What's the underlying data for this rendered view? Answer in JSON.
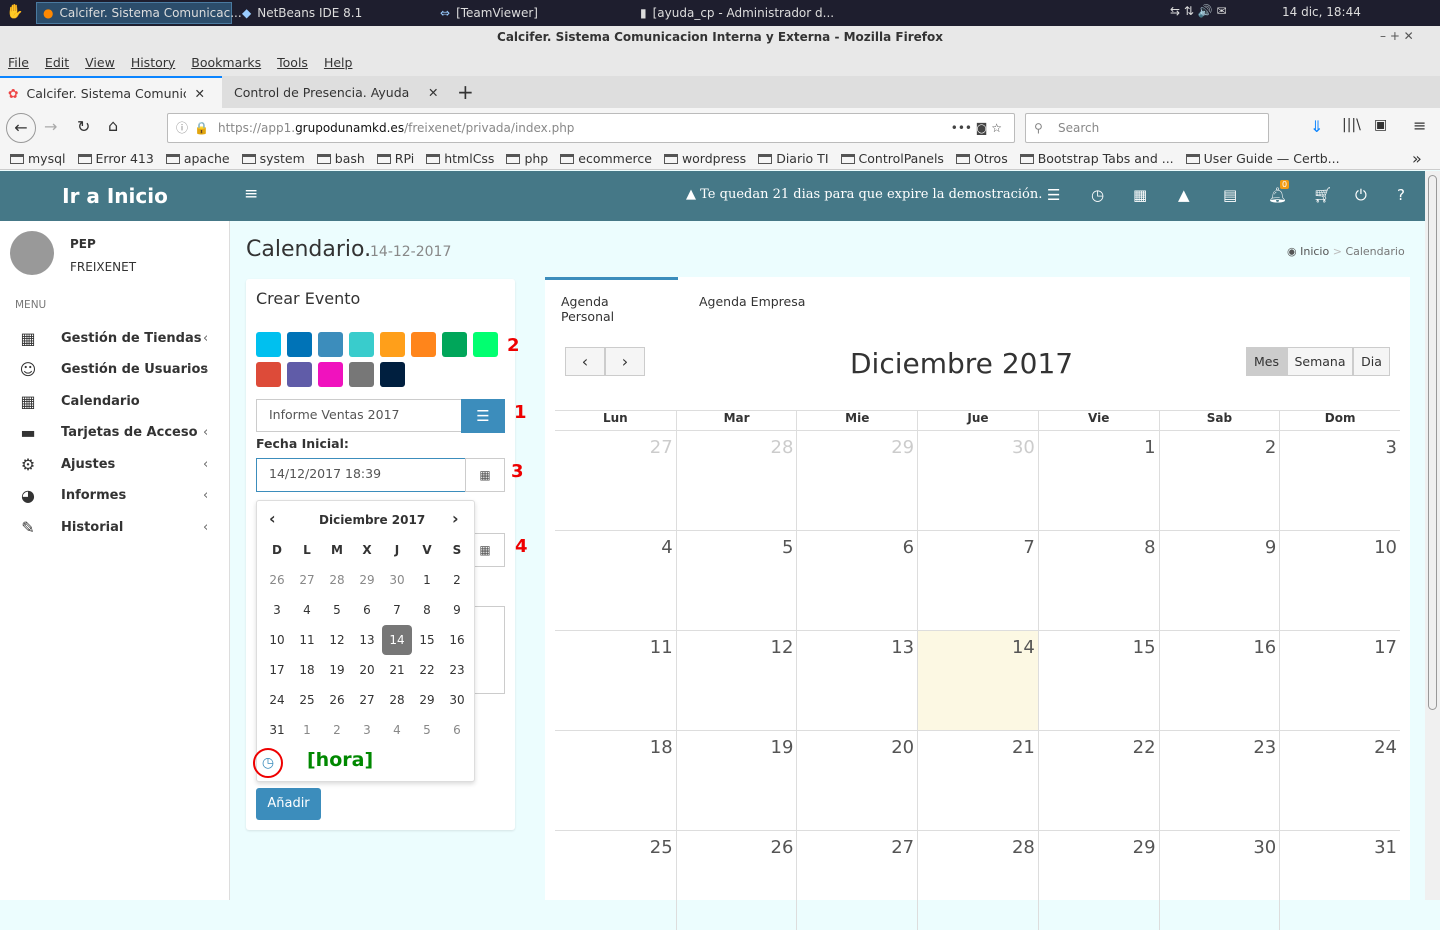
{
  "taskbar": {
    "tasks": [
      "Calcifer. Sistema Comunicac...",
      "NetBeans IDE 8.1",
      "[TeamViewer]",
      "[ayuda_cp - Administrador d..."
    ],
    "clock": "14 dic, 18:44"
  },
  "window_title": "Calcifer. Sistema Comunicacion Interna y Externa - Mozilla Firefox",
  "menu": [
    "File",
    "Edit",
    "View",
    "History",
    "Bookmarks",
    "Tools",
    "Help"
  ],
  "tabs": [
    "Calcifer. Sistema Comunicaci",
    "Control de Presencia. Ayuda"
  ],
  "url": {
    "prefix": "https://app1.",
    "domain": "grupodunamkd.es",
    "path": "/freixenet/privada/index.php"
  },
  "search_placeholder": "Search",
  "bookmarks": [
    "mysql",
    "Error 413",
    "apache",
    "system",
    "bash",
    "RPi",
    "htmlCss",
    "php",
    "ecommerce",
    "wordpress",
    "Diario TI",
    "ControlPanels",
    "Otros",
    "Bootstrap Tabs and ...",
    "User Guide — Certb..."
  ],
  "app": {
    "logo": "Ir a Inicio",
    "demo_notice": "Te quedan 21 dias para que expire la demostración.",
    "notif_count": "0"
  },
  "user": {
    "first": "PEP",
    "last": "FREIXENET"
  },
  "sidebar": {
    "menu_label": "MENU",
    "items": [
      {
        "label": "Gestión de Tiendas",
        "icon": "building-icon",
        "chev": true
      },
      {
        "label": "Gestión de Usuarios",
        "icon": "smile-icon",
        "chev": true
      },
      {
        "label": "Calendario",
        "icon": "calendar-icon",
        "chev": false
      },
      {
        "label": "Tarjetas de Acceso",
        "icon": "credit-card-icon",
        "chev": true
      },
      {
        "label": "Ajustes",
        "icon": "gear-icon",
        "chev": true
      },
      {
        "label": "Informes",
        "icon": "pie-chart-icon",
        "chev": true
      },
      {
        "label": "Historial",
        "icon": "edit-icon",
        "chev": true
      }
    ]
  },
  "page": {
    "title": "Calendario.",
    "date": "14-12-2017",
    "breadcrumb": [
      "Inicio",
      "Calendario"
    ]
  },
  "crear": {
    "title": "Crear Evento",
    "colors": [
      "#00c0ef",
      "#0073b7",
      "#3c8dbc",
      "#39cccc",
      "#ff9f1a",
      "#ff851b",
      "#00a65a",
      "#01ff70",
      "#dd4b39",
      "#605ca8",
      "#f012be",
      "#777777",
      "#001f3f"
    ],
    "event_name": "Informe Ventas 2017",
    "fecha_label": "Fecha Inicial:",
    "fecha_value": "14/12/2017 18:39",
    "add_label": "Añadir",
    "annotations": [
      "1",
      "2",
      "3",
      "4"
    ],
    "hora": "[hora]"
  },
  "picker": {
    "month": "Diciembre 2017",
    "weekdays": [
      "D",
      "L",
      "M",
      "X",
      "J",
      "V",
      "S"
    ],
    "days": [
      "26",
      "27",
      "28",
      "29",
      "30",
      "1",
      "2",
      "3",
      "4",
      "5",
      "6",
      "7",
      "8",
      "9",
      "10",
      "11",
      "12",
      "13",
      "14",
      "15",
      "16",
      "17",
      "18",
      "19",
      "20",
      "21",
      "22",
      "23",
      "24",
      "25",
      "26",
      "27",
      "28",
      "29",
      "30",
      "31",
      "1",
      "2",
      "3",
      "4",
      "5",
      "6"
    ],
    "selected": "14"
  },
  "calendar": {
    "tabs": [
      "Agenda Personal",
      "Agenda Empresa"
    ],
    "title": "Diciembre 2017",
    "views": [
      "Mes",
      "Semana",
      "Dia"
    ],
    "active_view": "Mes",
    "weekdays": [
      "Lun",
      "Mar",
      "Mie",
      "Jue",
      "Vie",
      "Sab",
      "Dom"
    ],
    "days": [
      "27",
      "28",
      "29",
      "30",
      "1",
      "2",
      "3",
      "4",
      "5",
      "6",
      "7",
      "8",
      "9",
      "10",
      "11",
      "12",
      "13",
      "14",
      "15",
      "16",
      "17",
      "18",
      "19",
      "20",
      "21",
      "22",
      "23",
      "24",
      "25",
      "26",
      "27",
      "28",
      "29",
      "30",
      "31"
    ],
    "today": "14"
  }
}
